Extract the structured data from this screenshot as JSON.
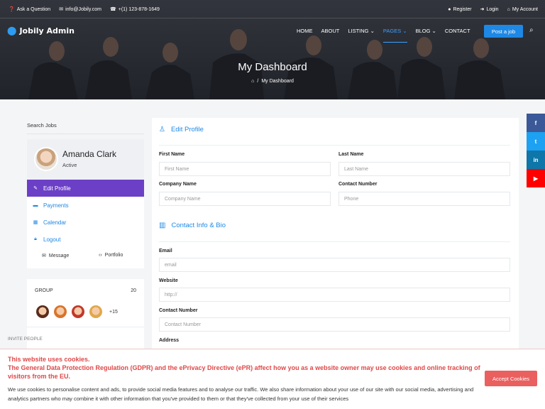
{
  "topbar": {
    "left": [
      {
        "icon": "question-circle-icon",
        "label": "Ask a Question"
      },
      {
        "icon": "envelope-icon",
        "label": "info@Jobily.com"
      },
      {
        "icon": "phone-icon",
        "label": "+(1) 123-878-1649"
      }
    ],
    "right": [
      {
        "icon": "user-icon",
        "label": "Register"
      },
      {
        "icon": "login-icon",
        "label": "Login"
      },
      {
        "icon": "account-icon",
        "label": "My Account"
      }
    ]
  },
  "brand": {
    "name": "Jobily Admin",
    "icon": "location-pin-icon",
    "accent": "#2d9cf0"
  },
  "nav": {
    "items": [
      {
        "label": "HOME",
        "dropdown": false,
        "active": false
      },
      {
        "label": "ABOUT",
        "dropdown": false,
        "active": false
      },
      {
        "label": "LISTING",
        "dropdown": true,
        "active": false
      },
      {
        "label": "PAGES",
        "dropdown": true,
        "active": true
      },
      {
        "label": "BLOG",
        "dropdown": true,
        "active": false
      },
      {
        "label": "CONTACT",
        "dropdown": false,
        "active": false
      }
    ],
    "post_button": "Post a job",
    "search_icon": "search-icon"
  },
  "hero": {
    "title": "My Dashboard",
    "breadcrumb_current": "My Dashboard",
    "breadcrumb_separator": "/"
  },
  "social": [
    {
      "icon": "facebook-icon",
      "glyph": "f",
      "color": "#3b5998"
    },
    {
      "icon": "twitter-icon",
      "glyph": "t",
      "color": "#1da1f2"
    },
    {
      "icon": "linkedin-icon",
      "glyph": "in",
      "color": "#0e76a8"
    },
    {
      "icon": "youtube-icon",
      "glyph": "▶",
      "color": "#ff0000"
    }
  ],
  "sidebar": {
    "search_label": "Search Jobs",
    "profile": {
      "name": "Amanda Clark",
      "status": "Active"
    },
    "menu": [
      {
        "label": "Edit Profile",
        "icon": "pencil-icon",
        "active": true
      },
      {
        "label": "Payments",
        "icon": "card-icon",
        "active": false
      },
      {
        "label": "Calendar",
        "icon": "calendar-icon",
        "active": false
      },
      {
        "label": "Logout",
        "icon": "lock-icon",
        "active": false
      }
    ],
    "quick_links": [
      {
        "label": "Message",
        "icon": "envelope-icon"
      },
      {
        "label": "Portfolio",
        "icon": "code-icon"
      }
    ],
    "active_color": "#6c3fc7",
    "group": {
      "title": "GROUP",
      "count": "20",
      "more": "+15",
      "invite": "INVITE PEOPLE"
    }
  },
  "form": {
    "edit_profile_title": "Edit Profile",
    "first_name": {
      "label": "First Name",
      "placeholder": "First Name"
    },
    "last_name": {
      "label": "Last Name",
      "placeholder": "Last Name"
    },
    "company_name": {
      "label": "Company Name",
      "placeholder": "Company Name"
    },
    "contact_number": {
      "label": "Contact Number",
      "placeholder": "Phone"
    },
    "contact_title": "Contact Info & Bio",
    "email": {
      "label": "Email",
      "placeholder": "email"
    },
    "website": {
      "label": "Website",
      "placeholder": "http://"
    },
    "contact_number2": {
      "label": "Contact Number",
      "placeholder": "Contact Number"
    },
    "address": {
      "label": "Address"
    }
  },
  "cookie": {
    "title": "This website uses cookies.",
    "subtitle": "The General Data Protection Regulation (GDPR) and the ePrivacy Directive (ePR) affect how you as a website owner may use cookies and online tracking of visitors from the EU.",
    "body": "We use cookies to personalise content and ads, to provide social media features and to analyse our traffic. We also share information about your use of our site with our social media, advertising and analytics partners who may combine it with other information that you've provided to them or that they've collected from your use of their services",
    "accept": "Accept Cookies",
    "accent": "#e9605f"
  }
}
